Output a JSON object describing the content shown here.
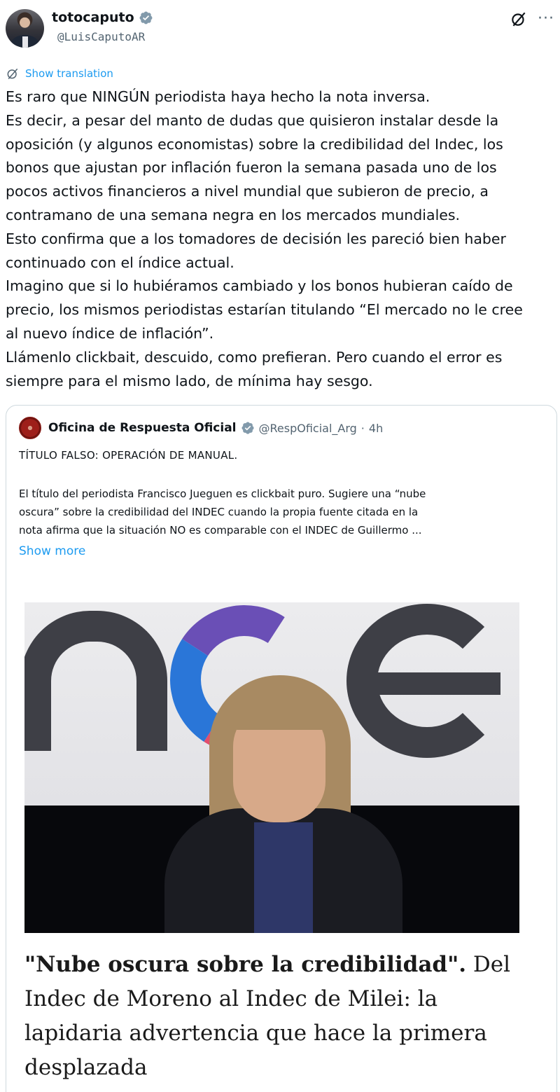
{
  "author": {
    "display_name": "totocaputo",
    "handle": "@LuisCaputoAR",
    "verified_icon": "verified-badge-icon"
  },
  "translate": {
    "label": "Show translation"
  },
  "tweet": {
    "lines": [
      "Es raro que NINGÚN periodista haya hecho la nota inversa.",
      "Es decir, a pesar del manto de dudas que quisieron instalar desde la",
      "oposición (y algunos economistas) sobre la credibilidad del Indec, los",
      "bonos que ajustan por inflación fueron la semana pasada uno de los",
      "pocos activos financieros a nivel mundial que subieron de precio, a",
      "contramano de una semana negra en los mercados mundiales.",
      "Esto confirma que a los tomadores de decisión les pareció bien haber",
      "continuado con el índice actual.",
      "Imagino que si lo hubiéramos cambiado y los bonos hubieran caído de",
      "precio, los mismos periodistas estarían titulando “El mercado no le cree",
      "al nuevo índice de inflación”.",
      "Llámenlo clickbait, descuido, como prefieran. Pero cuando el error es",
      "siempre para el mismo lado, de mínima hay sesgo."
    ]
  },
  "quote": {
    "display_name": "Oficina de Respuesta Oficial",
    "handle": "@RespOficial_Arg",
    "separator": "·",
    "time": "4h",
    "title": "TÍTULO FALSO: OPERACIÓN DE MANUAL.",
    "body_lines": [
      "El título del periodista Francisco Jueguen es clickbait puro. Sugiere una “nube",
      "oscura” sobre la credibilidad del INDEC cuando la propia fuente citada en la",
      "nota afirma que la situación NO es comparable con el INDEC de Guillermo ..."
    ],
    "show_more": "Show more",
    "headline_bold": "\"Nube oscura sobre la credibilidad\".",
    "headline_rest_first": " Del",
    "headline_lines": [
      "Indec de Moreno al Indec de Milei: la",
      "lapidaria advertencia que hace la primera",
      "desplazada"
    ]
  },
  "colors": {
    "link": "#1d9bf0",
    "text": "#0f1419",
    "secondary": "#536471",
    "border": "#cfd9de",
    "verified_badge": "#829aab"
  }
}
